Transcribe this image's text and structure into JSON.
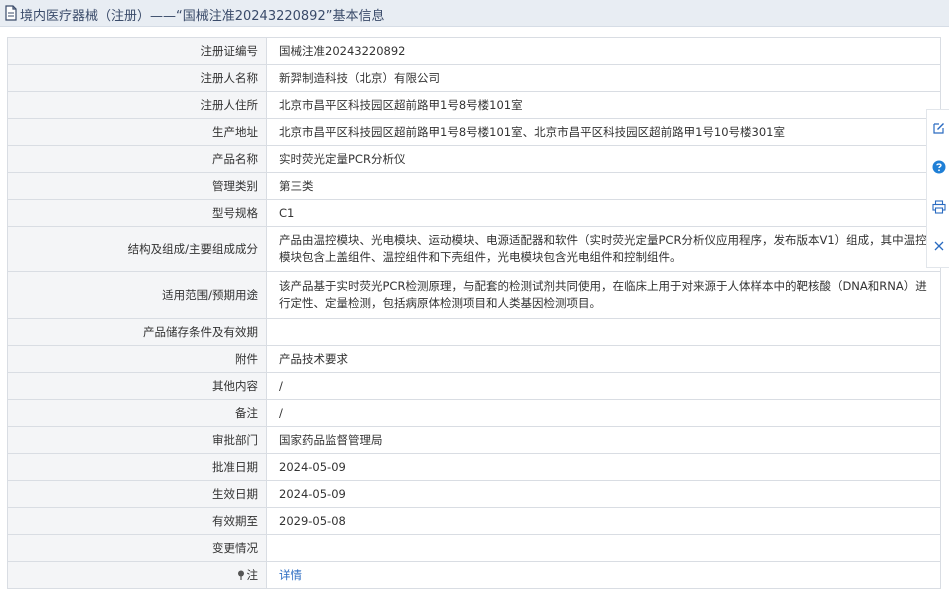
{
  "header": {
    "title": "境内医疗器械（注册）——“国械注准20243220892”基本信息"
  },
  "rows": [
    {
      "label": "注册证编号",
      "value": "国械注准20243220892"
    },
    {
      "label": "注册人名称",
      "value": "新羿制造科技（北京）有限公司"
    },
    {
      "label": "注册人住所",
      "value": "北京市昌平区科技园区超前路甲1号8号楼101室"
    },
    {
      "label": "生产地址",
      "value": "北京市昌平区科技园区超前路甲1号8号楼101室、北京市昌平区科技园区超前路甲1号10号楼301室"
    },
    {
      "label": "产品名称",
      "value": "实时荧光定量PCR分析仪"
    },
    {
      "label": "管理类别",
      "value": "第三类"
    },
    {
      "label": "型号规格",
      "value": "C1"
    },
    {
      "label": "结构及组成/主要组成成分",
      "value": "产品由温控模块、光电模块、运动模块、电源适配器和软件（实时荧光定量PCR分析仪应用程序，发布版本V1）组成，其中温控模块包含上盖组件、温控组件和下壳组件，光电模块包含光电组件和控制组件。"
    },
    {
      "label": "适用范围/预期用途",
      "value": "该产品基于实时荧光PCR检测原理，与配套的检测试剂共同使用，在临床上用于对来源于人体样本中的靶核酸（DNA和RNA）进行定性、定量检测，包括病原体检测项目和人类基因检测项目。"
    },
    {
      "label": "产品储存条件及有效期",
      "value": ""
    },
    {
      "label": "附件",
      "value": "产品技术要求"
    },
    {
      "label": "其他内容",
      "value": "/"
    },
    {
      "label": "备注",
      "value": "/"
    },
    {
      "label": "审批部门",
      "value": "国家药品监督管理局"
    },
    {
      "label": "批准日期",
      "value": "2024-05-09"
    },
    {
      "label": "生效日期",
      "value": "2024-05-09"
    },
    {
      "label": "有效期至",
      "value": "2029-05-08"
    },
    {
      "label": "变更情况",
      "value": ""
    },
    {
      "label": "注",
      "value": "详情"
    }
  ],
  "icons": {
    "title": "document-icon",
    "note": "pin-icon",
    "side": [
      "edit-icon",
      "help-icon",
      "print-icon",
      "close-icon"
    ]
  },
  "colors": {
    "accent": "#2a6bc1",
    "help": "#1f7fd6"
  }
}
